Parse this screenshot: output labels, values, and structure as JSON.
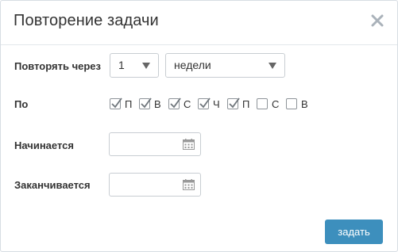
{
  "dialog": {
    "title": "Повторение задачи",
    "close_icon": "close-icon"
  },
  "form": {
    "repeat_label": "Повторять через",
    "interval_value": "1",
    "unit_value": "недели",
    "days_label": "По",
    "days": [
      {
        "label": "П",
        "checked": true
      },
      {
        "label": "В",
        "checked": true
      },
      {
        "label": "С",
        "checked": true
      },
      {
        "label": "Ч",
        "checked": true
      },
      {
        "label": "П",
        "checked": true
      },
      {
        "label": "С",
        "checked": false
      },
      {
        "label": "В",
        "checked": false
      }
    ],
    "start_label": "Начинается",
    "start_value": "",
    "end_label": "Заканчивается",
    "end_value": "",
    "calendar_icon": "calendar-icon"
  },
  "actions": {
    "submit_label": "задать"
  },
  "colors": {
    "button": "#3d8fbd",
    "border": "#c8cdd2"
  }
}
